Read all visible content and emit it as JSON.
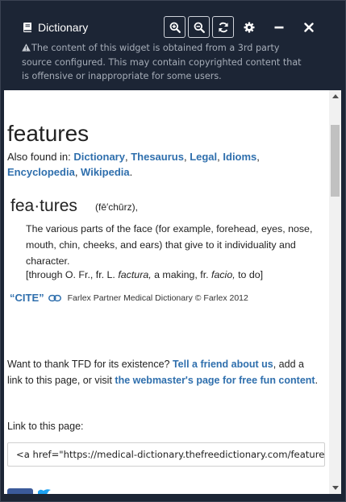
{
  "window": {
    "title": "Dictionary",
    "notice": "The content of this widget is obtained from a 3rd party source configured. This may contain copyrighted content that is offensive or inappropriate for some users."
  },
  "toolbar": {
    "zoom_in_icon": "zoom-in-icon",
    "zoom_out_icon": "zoom-out-icon",
    "refresh_icon": "refresh-icon",
    "settings_icon": "gear-icon",
    "minimize_icon": "minimize-icon",
    "close_icon": "close-icon"
  },
  "entry": {
    "word": "features",
    "also_found_prefix": "Also found in: ",
    "also_found": [
      "Dictionary",
      "Thesaurus",
      "Legal",
      "Idioms",
      "Encyclopedia",
      "Wikipedia"
    ],
    "headword": "fea·tures",
    "pronunciation": "(fē′chūrz),",
    "definition": "The various parts of the face (for example, forehead, eyes, nose, mouth, chin, cheeks, and ears) that give to it individuality and character.",
    "etymology_prefix": "[through O. Fr., fr. L. ",
    "etymology_factura": "factura,",
    "etymology_middle": " a making, fr. ",
    "etymology_facio": "facio,",
    "etymology_suffix": " to do]",
    "cite_label": "“CITE”",
    "source": "Farlex Partner Medical Dictionary © Farlex 2012"
  },
  "footer": {
    "thanks_1": "Want to thank TFD for its existence? ",
    "thanks_link_1": "Tell a friend about us",
    "thanks_2": ", add a link to this page, or visit ",
    "thanks_link_2": "the webmaster's page for free fun content",
    "thanks_3": ".",
    "link_label": "Link to this page:",
    "link_value": "<a href=\"https://medical-dictionary.thefreedictionary.com/features"
  },
  "colors": {
    "header_bg": "#1c2535",
    "link": "#2f6fad",
    "notice_text": "#a6adb8"
  }
}
